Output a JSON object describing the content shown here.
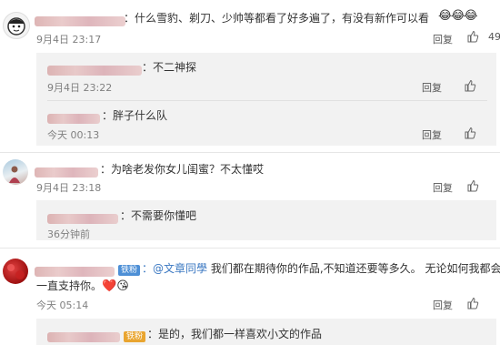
{
  "comments": [
    {
      "text": "：什么雪豹、剃刀、少帅等都看了好多遍了，有没有新作可以看",
      "emoji": "😂😂😂",
      "time": "9月4日 23:17",
      "reply_label": "回复",
      "like_count": "49",
      "replies": [
        {
          "text": "：不二神探",
          "time": "9月4日 23:22",
          "reply_label": "回复"
        },
        {
          "text": "：胖子什么队",
          "time": "今天 00:13",
          "reply_label": "回复"
        }
      ]
    },
    {
      "text": "：为啥老发你女儿闺蜜？不太懂哎",
      "time": "9月4日 23:18",
      "reply_label": "回复",
      "replies": [
        {
          "text": "：不需要你懂吧",
          "time": "36分钟前"
        }
      ]
    },
    {
      "badge": "铁粉",
      "mention": "：@文章同學",
      "text_line1": " 我们都在期待你的作品,不知道还要等多久。 无论如何我都会",
      "text_line2": "一直支持你。",
      "emoji": "❤️😘",
      "time": "今天 05:14",
      "reply_label": "回复",
      "replies": [
        {
          "badge": "铁粉",
          "text": "：是的，我们都一样喜欢小文的作品"
        }
      ]
    }
  ]
}
